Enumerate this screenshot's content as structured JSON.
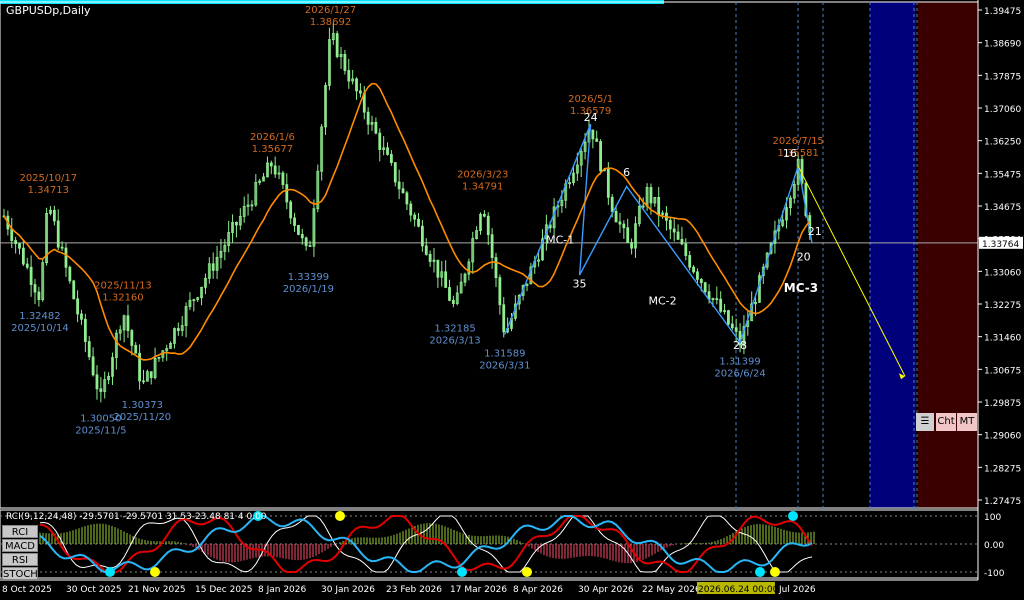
{
  "symbol": "GBPUSDp,Daily",
  "current_price": "1.33764",
  "price_axis_ticks": [
    "1.39475",
    "1.38690",
    "1.37875",
    "1.37060",
    "1.36250",
    "1.35475",
    "1.34675",
    "1.33764",
    "1.33060",
    "1.32275",
    "1.31460",
    "1.30675",
    "1.29875",
    "1.29060",
    "1.28275",
    "1.27475"
  ],
  "time_axis": [
    "8 Oct 2025",
    "30 Oct 2025",
    "21 Nov 2025",
    "15 Dec 2025",
    "8 Jan 2026",
    "30 Jan 2026",
    "23 Feb 2026",
    "17 Mar 2026",
    "8 Apr 2026",
    "30 Apr 2026",
    "22 May 2026",
    "2026.06.24 00:00",
    "Jul 2026"
  ],
  "buttons": {
    "grid": "☰",
    "cht": "Cht",
    "mt": "MT"
  },
  "subwindow": {
    "title": "RCI(9,12,24,48) -29.5701 -29.5701 31.53-23.48 81 4 0.00",
    "labels": [
      "RCI",
      "MACD",
      "RSI",
      "STOCH"
    ],
    "ticks": [
      "100",
      "0.00",
      "-100"
    ]
  },
  "colors": {
    "candle": "#90ee90",
    "ma": "#ff8c00",
    "zigzag": "#3a9bff",
    "projection": "#ffff00",
    "high_label": "#d2691e",
    "low_label": "#5f8fd0"
  },
  "chart_data": {
    "type": "line",
    "y_range": [
      1.27475,
      1.39475
    ],
    "x_range": [
      "2025-10-01",
      "2026-07-20"
    ],
    "pivots": [
      {
        "date": "2025-10-01",
        "price": 1.344
      },
      {
        "date": "2025-10-14",
        "price": 1.32482,
        "label": "1.32482",
        "sub": "2025/10/14",
        "kind": "low"
      },
      {
        "date": "2025-10-17",
        "price": 1.34713,
        "label": "1.34713",
        "sub": "2025/10/17",
        "kind": "high"
      },
      {
        "date": "2025-11-05",
        "price": 1.3005,
        "label": "1.30050",
        "sub": "2025/11/5",
        "kind": "low"
      },
      {
        "date": "2025-11-13",
        "price": 1.3216,
        "label": "1.32160",
        "sub": "2025/11/13",
        "kind": "high"
      },
      {
        "date": "2025-11-20",
        "price": 1.30373,
        "label": "1.30373",
        "sub": "2025/11/20",
        "kind": "low"
      },
      {
        "date": "2026-01-06",
        "price": 1.35677,
        "label": "1.35677",
        "sub": "2026/1/6",
        "kind": "high"
      },
      {
        "date": "2026-01-19",
        "price": 1.33399,
        "label": "1.33399",
        "sub": "2026/1/19",
        "kind": "low"
      },
      {
        "date": "2026-01-27",
        "price": 1.38692,
        "label": "1.38692",
        "sub": "2026/1/27",
        "kind": "high"
      },
      {
        "date": "2026-03-13",
        "price": 1.32185,
        "label": "1.32185",
        "sub": "2026/3/13",
        "kind": "low"
      },
      {
        "date": "2026-03-23",
        "price": 1.34791,
        "label": "1.34791",
        "sub": "2026/3/23",
        "kind": "high"
      },
      {
        "date": "2026-03-31",
        "price": 1.31589,
        "label": "1.31589",
        "sub": "2026/3/31",
        "kind": "low"
      },
      {
        "date": "2026-05-01",
        "price": 1.36579,
        "label": "1.36579",
        "sub": "2026/5/1",
        "kind": "high"
      },
      {
        "date": "2026-05-08",
        "price": 1.348
      },
      {
        "date": "2026-05-15",
        "price": 1.336
      },
      {
        "date": "2026-05-21",
        "price": 1.35
      },
      {
        "date": "2026-06-24",
        "price": 1.31399,
        "label": "1.31399",
        "sub": "2026/6/24",
        "kind": "low"
      },
      {
        "date": "2026-07-15",
        "price": 1.35581,
        "label": "1.35581",
        "sub": "2026/7/15",
        "kind": "high"
      },
      {
        "date": "2026-07-20",
        "price": 1.3376
      }
    ],
    "wave_labels": [
      {
        "text": "24",
        "date": "2026-05-01",
        "price": 1.3665
      },
      {
        "text": "6",
        "date": "2026-05-14",
        "price": 1.3535
      },
      {
        "text": "35",
        "date": "2026-04-27",
        "price": 1.327
      },
      {
        "text": "28",
        "date": "2026-06-24",
        "price": 1.3125
      },
      {
        "text": "16",
        "date": "2026-07-12",
        "price": 1.358
      },
      {
        "text": "21",
        "date": "2026-07-21",
        "price": 1.3395
      },
      {
        "text": "20",
        "date": "2026-07-17",
        "price": 1.3335
      },
      {
        "text": "MC-1",
        "date": "2026-04-20",
        "price": 1.3375
      },
      {
        "text": "MC-2",
        "date": "2026-05-27",
        "price": 1.323
      },
      {
        "text": "MC-3",
        "date": "2026-07-16",
        "price": 1.326
      }
    ]
  }
}
